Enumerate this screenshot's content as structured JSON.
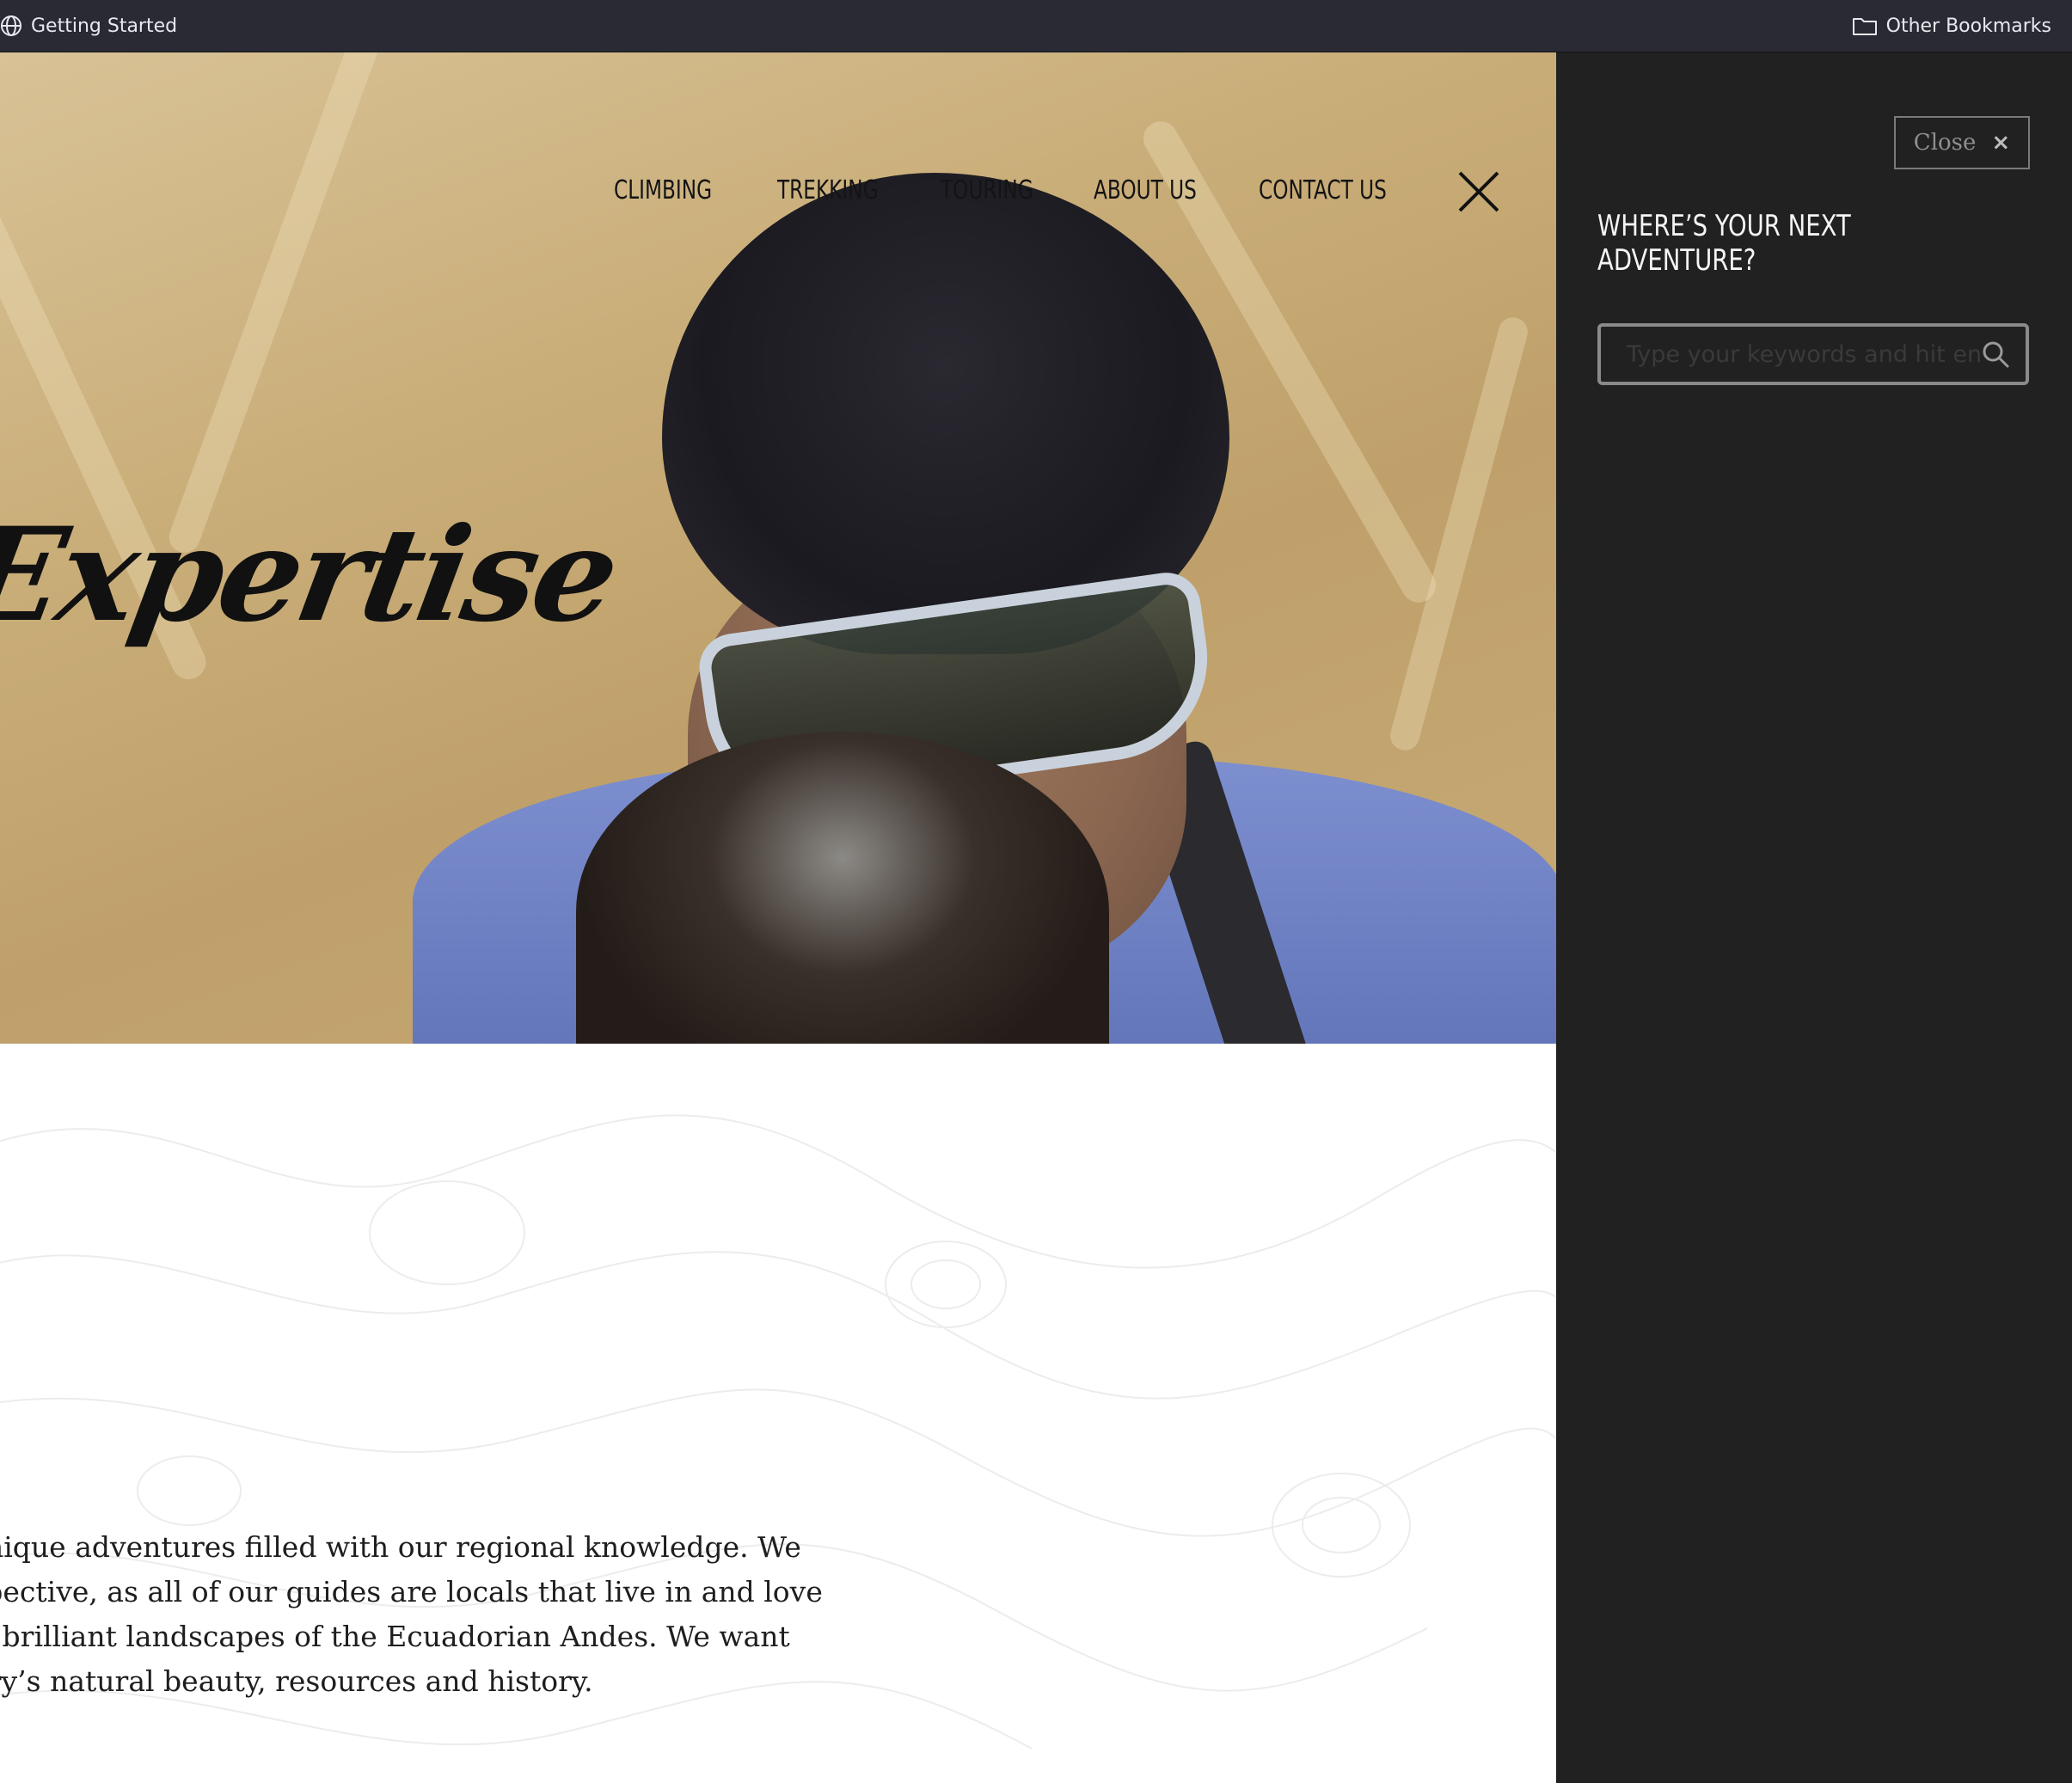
{
  "browser": {
    "bookmarks": [
      {
        "label": "Getting Started",
        "icon": "globe-icon"
      },
      {
        "label": "Other Bookmarks",
        "icon": "folder-icon"
      }
    ]
  },
  "nav": {
    "items": [
      "CLIMBING",
      "TREKKING",
      "TOURING",
      "ABOUT US",
      "CONTACT US"
    ],
    "close_icon": "close-icon"
  },
  "hero": {
    "headline": "Expertise"
  },
  "intro": {
    "lines": [
      "u unique adventures filled with our regional knowledge. We",
      "erspective, as all of our guides are locals that live in and love",
      " and brilliant landscapes of the Ecuadorian Andes. We want",
      "untry’s natural beauty, resources and history."
    ]
  },
  "search_panel": {
    "close_label": "Close",
    "close_x": "×",
    "heading": "WHERE’S YOUR NEXT ADVENTURE?",
    "search_placeholder": "Type your keywords and hit enter",
    "search_value": "",
    "search_icon": "search-icon"
  },
  "colors": {
    "bookmarks_bar": "#2a2a35",
    "panel_bg": "#212121",
    "nav_text": "#141414"
  }
}
